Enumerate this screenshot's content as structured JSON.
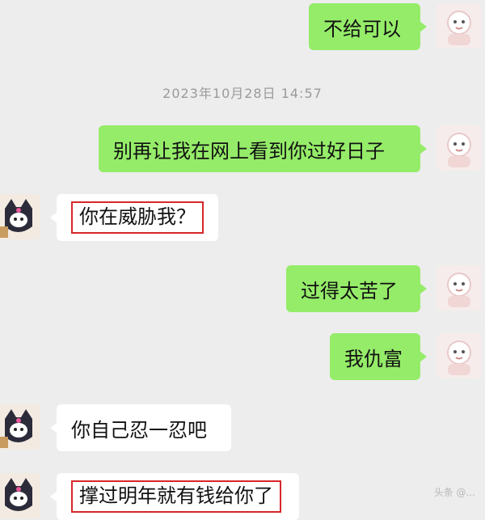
{
  "chat": {
    "timestamp": "2023年10月28日 14:57",
    "messages": [
      {
        "side": "me",
        "text": "不给可以"
      },
      {
        "side": "me",
        "text": "别再让我在网上看到你过好日子"
      },
      {
        "side": "other",
        "text": "你在威胁我？",
        "highlighted": true
      },
      {
        "side": "me",
        "text": "过得太苦了"
      },
      {
        "side": "me",
        "text": "我仇富"
      },
      {
        "side": "other",
        "text": "你自己忍一忍吧"
      },
      {
        "side": "other",
        "text": "撑过明年就有钱给你了",
        "highlighted": true
      }
    ]
  },
  "colors": {
    "background": "#ededed",
    "my_bubble": "#95ec69",
    "other_bubble": "#ffffff",
    "highlight_box": "#d6262a"
  },
  "avatars": {
    "me": "cartoon-avatar-icon",
    "other": "kuromi-avatar-icon"
  },
  "watermark": "头条 @..."
}
